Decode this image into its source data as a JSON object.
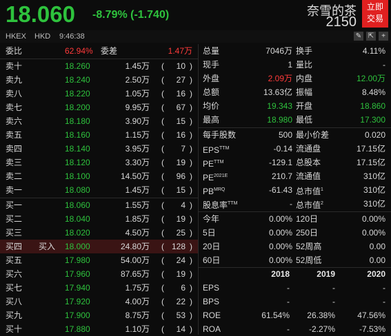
{
  "header": {
    "price": "18.060",
    "change": "-8.79% (-1.740)",
    "stock_name": "奈雪的茶",
    "stock_code": "2150",
    "trade_btn_line1": "立即",
    "trade_btn_line2": "交易"
  },
  "subheader": {
    "exchange": "HKEX",
    "currency": "HKD",
    "time": "9:46:38"
  },
  "commission": {
    "ratio_label": "委比",
    "ratio_value": "62.94%",
    "diff_label": "委差",
    "diff_value": "1.47万"
  },
  "asks": [
    {
      "label": "卖十",
      "price": "18.260",
      "volume": "1.45万",
      "orders": "10"
    },
    {
      "label": "卖九",
      "price": "18.240",
      "volume": "2.50万",
      "orders": "27"
    },
    {
      "label": "卖八",
      "price": "18.220",
      "volume": "1.05万",
      "orders": "16"
    },
    {
      "label": "卖七",
      "price": "18.200",
      "volume": "9.95万",
      "orders": "67"
    },
    {
      "label": "卖六",
      "price": "18.180",
      "volume": "3.90万",
      "orders": "15"
    },
    {
      "label": "卖五",
      "price": "18.160",
      "volume": "1.15万",
      "orders": "16"
    },
    {
      "label": "卖四",
      "price": "18.140",
      "volume": "3.95万",
      "orders": "7"
    },
    {
      "label": "卖三",
      "price": "18.120",
      "volume": "3.30万",
      "orders": "19"
    },
    {
      "label": "卖二",
      "price": "18.100",
      "volume": "14.50万",
      "orders": "96"
    },
    {
      "label": "卖一",
      "price": "18.080",
      "volume": "1.45万",
      "orders": "15"
    }
  ],
  "bids": [
    {
      "label": "买一",
      "tag": "",
      "price": "18.060",
      "volume": "1.55万",
      "orders": "4"
    },
    {
      "label": "买二",
      "tag": "",
      "price": "18.040",
      "volume": "1.85万",
      "orders": "19"
    },
    {
      "label": "买三",
      "tag": "",
      "price": "18.020",
      "volume": "4.50万",
      "orders": "25"
    },
    {
      "label": "买四",
      "tag": "买入",
      "price": "18.000",
      "volume": "24.80万",
      "orders": "128"
    },
    {
      "label": "买五",
      "tag": "",
      "price": "17.980",
      "volume": "54.00万",
      "orders": "24"
    },
    {
      "label": "买六",
      "tag": "",
      "price": "17.960",
      "volume": "87.65万",
      "orders": "19"
    },
    {
      "label": "买七",
      "tag": "",
      "price": "17.940",
      "volume": "1.75万",
      "orders": "6"
    },
    {
      "label": "买八",
      "tag": "",
      "price": "17.920",
      "volume": "4.00万",
      "orders": "22"
    },
    {
      "label": "买九",
      "tag": "",
      "price": "17.900",
      "volume": "8.75万",
      "orders": "53"
    },
    {
      "label": "买十",
      "tag": "",
      "price": "17.880",
      "volume": "1.10万",
      "orders": "14"
    }
  ],
  "stats": [
    {
      "l1": "总量",
      "v1": "7046万",
      "c1": "w",
      "l2": "换手",
      "v2": "4.11%",
      "c2": "w"
    },
    {
      "l1": "现手",
      "v1": "1",
      "c1": "w",
      "l2": "量比",
      "v2": "-",
      "c2": "w"
    },
    {
      "l1": "外盘",
      "v1": "2.09万",
      "c1": "r",
      "l2": "内盘",
      "v2": "12.00万",
      "c2": "g"
    },
    {
      "l1": "总额",
      "v1": "13.63亿",
      "c1": "w",
      "l2": "振幅",
      "v2": "8.48%",
      "c2": "w"
    },
    {
      "l1": "均价",
      "v1": "19.343",
      "c1": "g",
      "l2": "开盘",
      "v2": "18.860",
      "c2": "g"
    },
    {
      "l1": "最高",
      "v1": "18.980",
      "c1": "g",
      "l2": "最低",
      "v2": "17.300",
      "c2": "g"
    }
  ],
  "fundamentals": [
    {
      "l1": "每手股数",
      "s1": "",
      "v1": "500",
      "l2": "最小价差",
      "s2": "",
      "v2": "0.020"
    },
    {
      "l1": "EPS",
      "s1": "TTM",
      "v1": "-0.14",
      "l2": "流通盘",
      "s2": "",
      "v2": "17.15亿"
    },
    {
      "l1": "PE",
      "s1": "TTM",
      "v1": "-129.1",
      "l2": "总股本",
      "s2": "",
      "v2": "17.15亿"
    },
    {
      "l1": "PE",
      "s1": "2021E",
      "v1": "210.7",
      "l2": "流通值",
      "s2": "",
      "v2": "310亿"
    },
    {
      "l1": "PB",
      "s1": "MRQ",
      "v1": "-61.43",
      "l2": "总市值",
      "s2": "1",
      "v2": "310亿"
    },
    {
      "l1": "股息率",
      "s1": "TTM",
      "v1": "-",
      "l2": "总市值",
      "s2": "2",
      "v2": "310亿"
    }
  ],
  "periods": [
    {
      "l1": "今年",
      "v1": "0.00%",
      "l2": "120日",
      "v2": "0.00%"
    },
    {
      "l1": "5日",
      "v1": "0.00%",
      "l2": "250日",
      "v2": "0.00%"
    },
    {
      "l1": "20日",
      "v1": "0.00%",
      "l2": "52周高",
      "v2": "0.00"
    },
    {
      "l1": "60日",
      "v1": "0.00%",
      "l2": "52周低",
      "v2": "0.00"
    }
  ],
  "annual": {
    "years": [
      "2018",
      "2019",
      "2020"
    ],
    "rows": [
      {
        "label": "EPS",
        "values": [
          "-",
          "-",
          "-"
        ],
        "colors": [
          "w",
          "w",
          "w"
        ]
      },
      {
        "label": "BPS",
        "values": [
          "-",
          "-",
          "-"
        ],
        "colors": [
          "w",
          "w",
          "w"
        ]
      },
      {
        "label": "ROE",
        "values": [
          "61.54%",
          "26.38%",
          "47.56%"
        ],
        "colors": [
          "w",
          "w",
          "w"
        ]
      },
      {
        "label": "ROA",
        "values": [
          "-",
          "-2.27%",
          "-7.53%"
        ],
        "colors": [
          "w",
          "w",
          "w"
        ]
      }
    ]
  },
  "icons": [
    "edit-icon",
    "share-icon",
    "add-icon"
  ],
  "colors": {
    "up": "#ff3a3a",
    "down": "#2ec23d",
    "accent": "#e02020"
  }
}
